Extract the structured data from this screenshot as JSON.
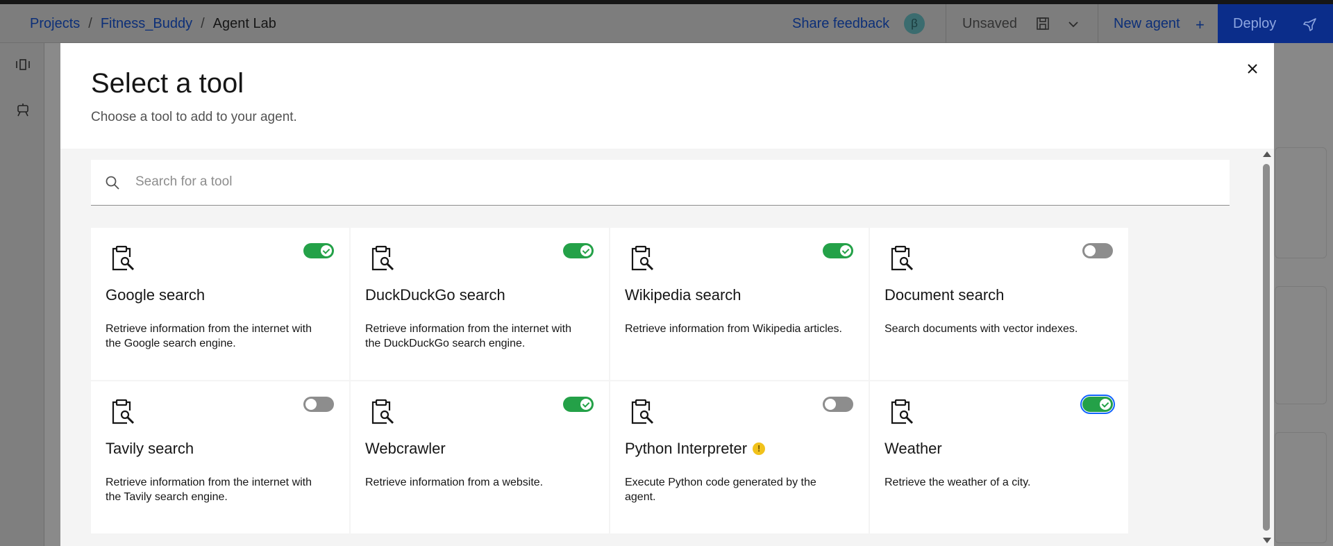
{
  "breadcrumb": {
    "projects": "Projects",
    "project": "Fitness_Buddy",
    "current": "Agent Lab",
    "sep": "/"
  },
  "header": {
    "share_feedback": "Share feedback",
    "beta_badge": "β",
    "status": "Unsaved",
    "new_agent": "New agent",
    "new_agent_plus": "+",
    "deploy": "Deploy"
  },
  "modal": {
    "title": "Select a tool",
    "subtitle": "Choose a tool to add to your agent.",
    "close_glyph": "✕",
    "search_placeholder": "Search for a tool"
  },
  "tools": [
    {
      "name": "Google search",
      "description": "Retrieve information from the internet with the Google search engine.",
      "enabled": true
    },
    {
      "name": "DuckDuckGo search",
      "description": "Retrieve information from the internet with the DuckDuckGo search engine.",
      "enabled": true
    },
    {
      "name": "Wikipedia search",
      "description": "Retrieve information from Wikipedia articles.",
      "enabled": true
    },
    {
      "name": "Document search",
      "description": "Search documents with vector indexes.",
      "enabled": false
    },
    {
      "name": "Tavily search",
      "description": "Retrieve information from the internet with the Tavily search engine.",
      "enabled": false
    },
    {
      "name": "Webcrawler",
      "description": "Retrieve information from a website.",
      "enabled": true
    },
    {
      "name": "Python Interpreter",
      "description": "Execute Python code generated by the agent.",
      "enabled": false,
      "warning": true
    },
    {
      "name": "Weather",
      "description": "Retrieve the weather of a city.",
      "enabled": true,
      "focused": true
    }
  ],
  "colors": {
    "toggle_on": "#24a148",
    "toggle_off": "#8d8d8d",
    "deploy_bg": "#0b2d8a",
    "link": "#0f62fe",
    "warning": "#f1c21b"
  },
  "icons": {
    "tool": "clipboard-wrench-icon",
    "search": "search-icon",
    "close": "close-icon",
    "save": "save-icon",
    "chevron": "chevron-down-icon",
    "deploy": "rocket-icon"
  }
}
